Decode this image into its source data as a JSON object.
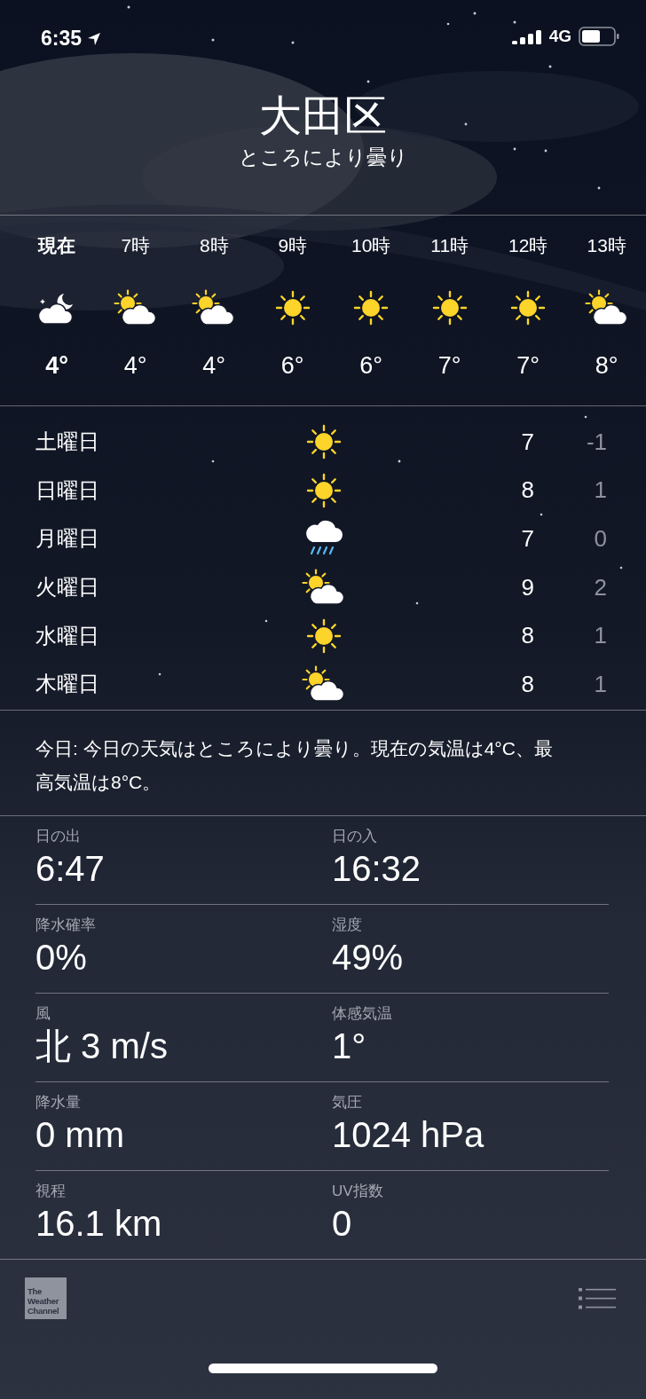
{
  "status_bar": {
    "time": "6:35",
    "network": "4G"
  },
  "location": {
    "city": "大田区",
    "condition": "ところにより曇り"
  },
  "hourly": [
    {
      "time": "現在",
      "kind": "moon-cloud",
      "temp": "4°",
      "now": true
    },
    {
      "time": "7時",
      "kind": "sun-cloud",
      "temp": "4°",
      "now": false
    },
    {
      "time": "8時",
      "kind": "sun-cloud",
      "temp": "4°",
      "now": false
    },
    {
      "time": "9時",
      "kind": "sun",
      "temp": "6°",
      "now": false
    },
    {
      "time": "10時",
      "kind": "sun",
      "temp": "6°",
      "now": false
    },
    {
      "time": "11時",
      "kind": "sun",
      "temp": "7°",
      "now": false
    },
    {
      "time": "12時",
      "kind": "sun",
      "temp": "7°",
      "now": false
    },
    {
      "time": "13時",
      "kind": "sun-cloud",
      "temp": "8°",
      "now": false
    }
  ],
  "daily": [
    {
      "day": "土曜日",
      "kind": "sun",
      "high": "7",
      "low": "-1"
    },
    {
      "day": "日曜日",
      "kind": "sun",
      "high": "8",
      "low": "1"
    },
    {
      "day": "月曜日",
      "kind": "rain",
      "high": "7",
      "low": "0"
    },
    {
      "day": "火曜日",
      "kind": "sun-cloud",
      "high": "9",
      "low": "2"
    },
    {
      "day": "水曜日",
      "kind": "sun",
      "high": "8",
      "low": "1"
    },
    {
      "day": "木曜日",
      "kind": "sun-cloud",
      "high": "8",
      "low": "1"
    }
  ],
  "summary": "今日: 今日の天気はところにより曇り。現在の気温は4°C、最高気温は8°C。",
  "details": [
    {
      "label": "日の出",
      "value": "6:47"
    },
    {
      "label": "日の入",
      "value": "16:32"
    },
    {
      "label": "降水確率",
      "value": "0%"
    },
    {
      "label": "湿度",
      "value": "49%"
    },
    {
      "label": "風",
      "value": "北 3 m/s"
    },
    {
      "label": "体感気温",
      "value": "1°"
    },
    {
      "label": "降水量",
      "value": "0 mm"
    },
    {
      "label": "気圧",
      "value": "1024 hPa"
    },
    {
      "label": "視程",
      "value": "16.1 km"
    },
    {
      "label": "UV指数",
      "value": "0"
    }
  ],
  "footer": {
    "logo": "The Weather Channel"
  }
}
